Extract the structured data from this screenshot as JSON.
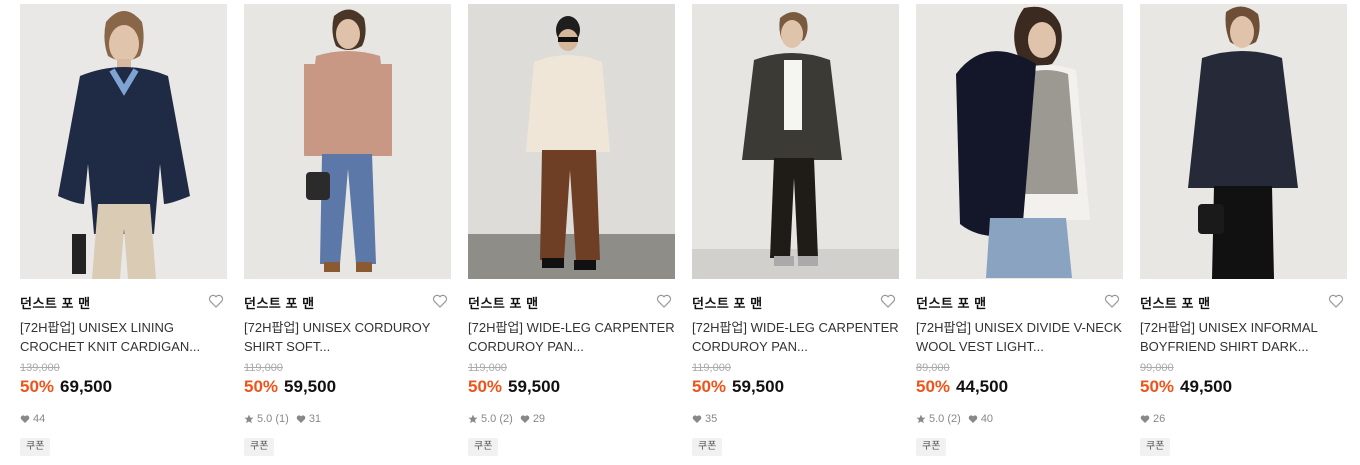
{
  "products": [
    {
      "brand": "던스트 포 맨",
      "name": "[72H팝업] UNISEX LINING CROCHET KNIT CARDIGAN...",
      "original_price": "139,000",
      "discount": "50%",
      "price": "69,500",
      "rating": "",
      "reviews": "",
      "likes": "44",
      "coupon": "쿠폰"
    },
    {
      "brand": "던스트 포 맨",
      "name": "[72H팝업] UNISEX CORDUROY SHIRT SOFT...",
      "original_price": "119,000",
      "discount": "50%",
      "price": "59,500",
      "rating": "5.0",
      "reviews": "(1)",
      "likes": "31",
      "coupon": "쿠폰"
    },
    {
      "brand": "던스트 포 맨",
      "name": "[72H팝업] WIDE-LEG CARPENTER CORDUROY PAN...",
      "original_price": "119,000",
      "discount": "50%",
      "price": "59,500",
      "rating": "5.0",
      "reviews": "(2)",
      "likes": "29",
      "coupon": "쿠폰"
    },
    {
      "brand": "던스트 포 맨",
      "name": "[72H팝업] WIDE-LEG CARPENTER CORDUROY PAN...",
      "original_price": "119,000",
      "discount": "50%",
      "price": "59,500",
      "rating": "",
      "reviews": "",
      "likes": "35",
      "coupon": "쿠폰"
    },
    {
      "brand": "던스트 포 맨",
      "name": "[72H팝업] UNISEX DIVIDE V-NECK WOOL VEST LIGHT...",
      "original_price": "89,000",
      "discount": "50%",
      "price": "44,500",
      "rating": "5.0",
      "reviews": "(2)",
      "likes": "40",
      "coupon": "쿠폰"
    },
    {
      "brand": "던스트 포 맨",
      "name": "[72H팝업] UNISEX INFORMAL BOYFRIEND SHIRT DARK...",
      "original_price": "99,000",
      "discount": "50%",
      "price": "49,500",
      "rating": "",
      "reviews": "",
      "likes": "26",
      "coupon": "쿠폰"
    }
  ],
  "colors": {
    "discount": "#f0541a",
    "meta": "#888888",
    "image_bg": "#e9e8e6"
  },
  "icons": {
    "wishlist": "heart-outline-icon",
    "star": "star-icon",
    "like": "heart-filled-icon"
  }
}
